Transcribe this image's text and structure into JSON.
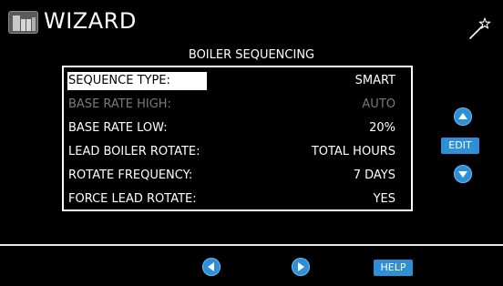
{
  "header": {
    "title": "WIZARD",
    "logo_icon": "app-logo-icon",
    "wizard_icon": "magic-wand-icon"
  },
  "page": {
    "title": "BOILER SEQUENCING"
  },
  "settings": [
    {
      "label": "SEQUENCE TYPE:",
      "value": "SMART",
      "selected": true,
      "enabled": true
    },
    {
      "label": "BASE RATE HIGH:",
      "value": "AUTO",
      "selected": false,
      "enabled": false
    },
    {
      "label": "BASE RATE LOW:",
      "value": "20%",
      "selected": false,
      "enabled": true
    },
    {
      "label": "LEAD BOILER ROTATE:",
      "value": "TOTAL HOURS",
      "selected": false,
      "enabled": true
    },
    {
      "label": "ROTATE FREQUENCY:",
      "value": "7 DAYS",
      "selected": false,
      "enabled": true
    },
    {
      "label": "FORCE LEAD ROTATE:",
      "value": "YES",
      "selected": false,
      "enabled": true
    }
  ],
  "controls": {
    "edit_label": "EDIT",
    "help_label": "HELP",
    "up_icon": "arrow-up-icon",
    "down_icon": "arrow-down-icon",
    "prev_icon": "arrow-left-icon",
    "next_icon": "arrow-right-icon"
  },
  "colors": {
    "background": "#000000",
    "text": "#ffffff",
    "disabled_text": "#7a7a7a",
    "button_blue": "#2e8fd6",
    "selection": "#ffffff"
  }
}
